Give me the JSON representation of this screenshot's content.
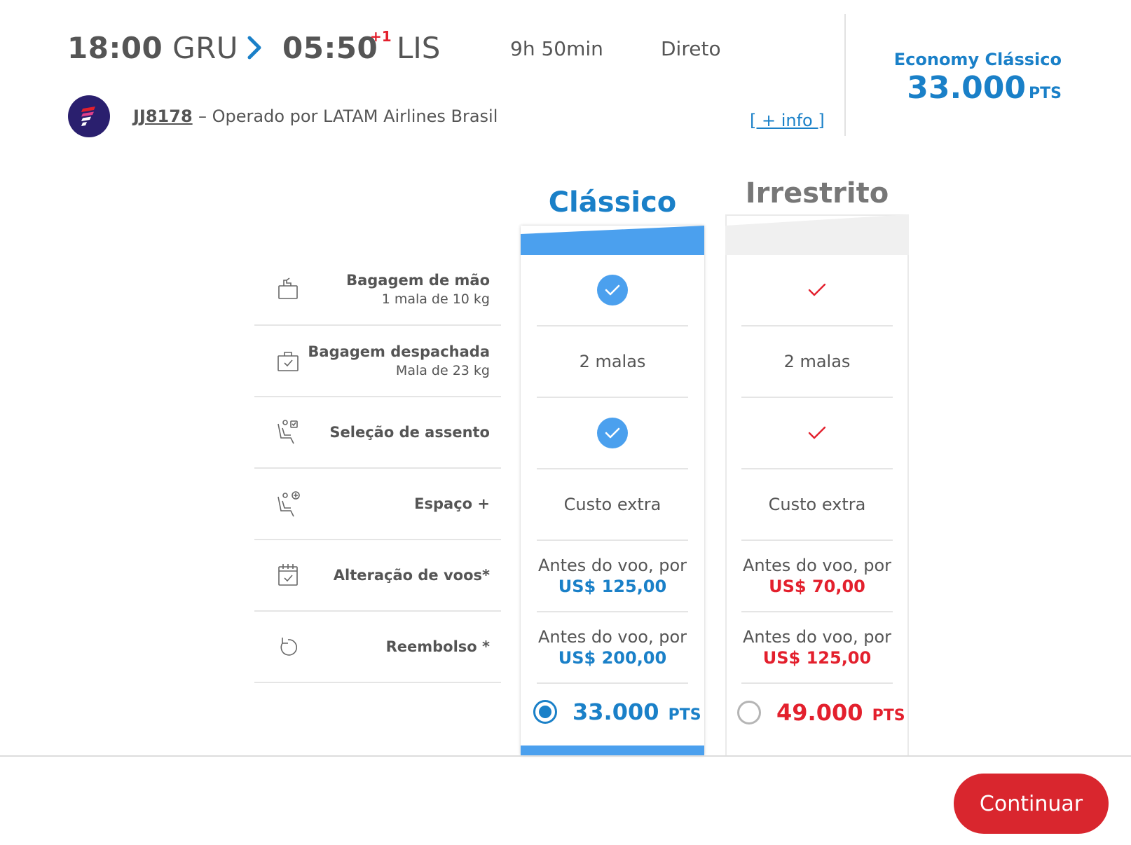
{
  "flight": {
    "departure_time": "18:00",
    "departure_code": "GRU",
    "arrival_time": "05:50",
    "arrival_day_offset": "+1",
    "arrival_code": "LIS",
    "duration": "9h 50min",
    "stops": "Direto",
    "flight_number": "JJ8178",
    "operated_by": "– Operado por LATAM Airlines Brasil",
    "info_link": "[ + info ]"
  },
  "summary": {
    "cabin": "Economy Clássico",
    "price": "33.000",
    "unit": "PTS"
  },
  "features": [
    {
      "icon": "carry-on-bag-icon",
      "title": "Bagagem de mão",
      "subtitle": "1 mala de 10 kg"
    },
    {
      "icon": "checked-bag-icon",
      "title": "Bagagem despachada",
      "subtitle": "Mala de 23 kg"
    },
    {
      "icon": "seat-selection-icon",
      "title": "Seleção de assento",
      "subtitle": ""
    },
    {
      "icon": "seat-plus-icon",
      "title": "Espaço +",
      "subtitle": ""
    },
    {
      "icon": "calendar-check-icon",
      "title": "Alteração de voos*",
      "subtitle": ""
    },
    {
      "icon": "refund-icon",
      "title": "Reembolso *",
      "subtitle": ""
    }
  ],
  "fares": [
    {
      "name": "Clássico",
      "selected": true,
      "carry_on": "check",
      "checked_bag": "2 malas",
      "seat_selection": "check",
      "extra_space": "Custo extra",
      "change_text": "Antes do voo, por",
      "change_price": "US$ 125,00",
      "refund_text": "Antes do voo, por",
      "refund_price": "US$ 200,00",
      "price": "33.000",
      "unit": "PTS"
    },
    {
      "name": "Irrestrito",
      "selected": false,
      "carry_on": "check",
      "checked_bag": "2 malas",
      "seat_selection": "check",
      "extra_space": "Custo extra",
      "change_text": "Antes do voo, por",
      "change_price": "US$ 70,00",
      "refund_text": "Antes do voo, por",
      "refund_price": "US$ 125,00",
      "price": "49.000",
      "unit": "PTS"
    }
  ],
  "colors": {
    "brand_blue": "#1a80c8",
    "accent_blue": "#4ba0ee",
    "brand_red": "#e3202d",
    "button_red": "#d9262e"
  },
  "footer": {
    "continue_label": "Continuar"
  }
}
